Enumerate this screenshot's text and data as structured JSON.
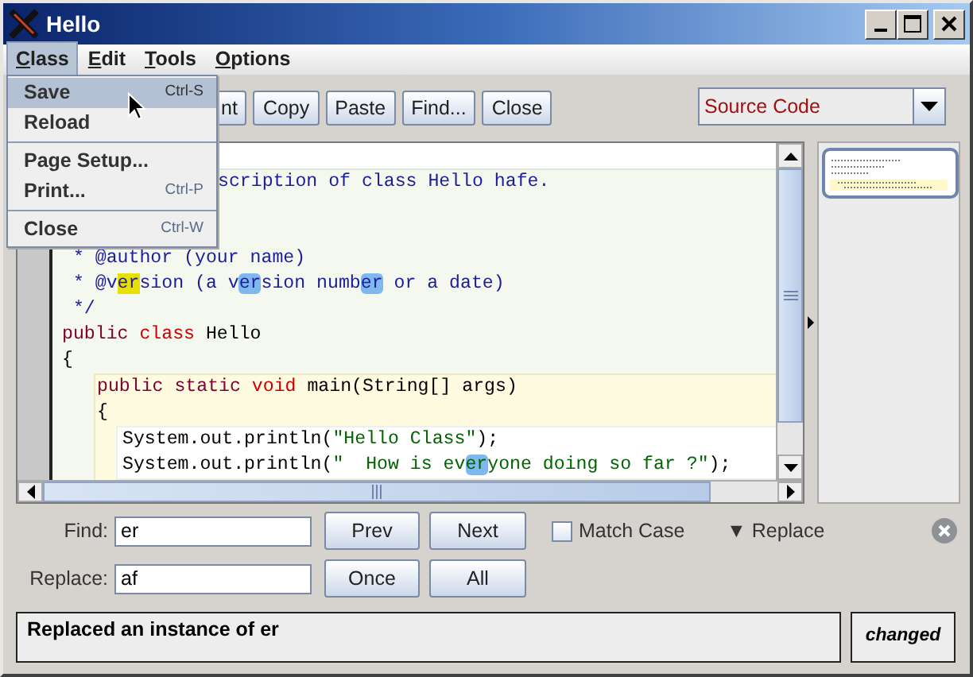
{
  "window": {
    "title": "Hello"
  },
  "menubar": [
    {
      "label": "Class",
      "selected": true
    },
    {
      "label": "Edit",
      "selected": false
    },
    {
      "label": "Tools",
      "selected": false
    },
    {
      "label": "Options",
      "selected": false
    }
  ],
  "open_menu": {
    "groups": [
      [
        {
          "label": "Save",
          "shortcut": "Ctrl-S",
          "selected": true
        },
        {
          "label": "Reload",
          "selected": false
        }
      ],
      [
        {
          "label": "Page Setup...",
          "selected": false
        },
        {
          "label": "Print...",
          "shortcut": "Ctrl-P",
          "selected": false
        }
      ],
      [
        {
          "label": "Close",
          "shortcut": "Ctrl-W",
          "selected": false
        }
      ]
    ]
  },
  "toolbar": {
    "buttons": [
      "nt",
      "Copy",
      "Paste",
      "Find...",
      "Close"
    ],
    "view_select": "Source Code"
  },
  "code": {
    "kind": "class",
    "lines": [
      [
        {
          "text": "scription of class Hello hafe.",
          "kind": "comment"
        }
      ],
      [
        {
          "text": " * @author (your name)",
          "kind": "comment"
        }
      ],
      [
        {
          "text": " * @v",
          "kind": "comment"
        },
        {
          "text": "er",
          "kind": "comment",
          "match": true,
          "current": true
        },
        {
          "text": "sion (a v",
          "kind": "comment"
        },
        {
          "text": "er",
          "kind": "comment",
          "match": true,
          "current": false
        },
        {
          "text": "sion numb",
          "kind": "comment"
        },
        {
          "text": "er",
          "kind": "comment",
          "match": true,
          "current": false
        },
        {
          "text": " or a date)",
          "kind": "comment"
        }
      ],
      [
        {
          "text": " */",
          "kind": "comment"
        }
      ],
      [
        {
          "text": "public",
          "kind": "keyword"
        },
        {
          "text": " class",
          "kind": "type"
        },
        {
          "text": " Hello",
          "kind": "plain"
        }
      ],
      [
        {
          "text": "{",
          "kind": "plain"
        }
      ]
    ],
    "children": [
      {
        "kind": "method",
        "lines": [
          [
            {
              "text": "public static",
              "kind": "keyword"
            },
            {
              "text": " void",
              "kind": "type"
            },
            {
              "text": " main(String[] args)",
              "kind": "plain"
            }
          ],
          [
            {
              "text": "{",
              "kind": "plain"
            }
          ]
        ],
        "children": [
          {
            "kind": "body",
            "lines": [
              [
                {
                  "text": "System.out.println(",
                  "kind": "plain"
                },
                {
                  "text": "\"Hello Class\"",
                  "kind": "string"
                },
                {
                  "text": ");",
                  "kind": "plain"
                }
              ],
              [
                {
                  "text": "System.out.println(",
                  "kind": "plain"
                },
                {
                  "text": "\"  How is ev",
                  "kind": "string"
                },
                {
                  "text": "er",
                  "kind": "string",
                  "match": true,
                  "current": false
                },
                {
                  "text": "yone doing so far ?\"",
                  "kind": "string"
                },
                {
                  "text": ");",
                  "kind": "plain"
                }
              ]
            ]
          }
        ]
      }
    ]
  },
  "find_panel": {
    "find_label": "Find:",
    "find_value": "er",
    "replace_label": "Replace:",
    "replace_value": "af",
    "buttons": [
      "Prev",
      "Next"
    ],
    "replace_buttons": [
      "Once",
      "All"
    ],
    "match_case": {
      "label": "Match Case",
      "checked": false
    },
    "replace_toggle": {
      "icon": "▼",
      "label": "Replace"
    }
  },
  "status_bar": {
    "message": "Replaced an instance of er",
    "state": "changed"
  }
}
